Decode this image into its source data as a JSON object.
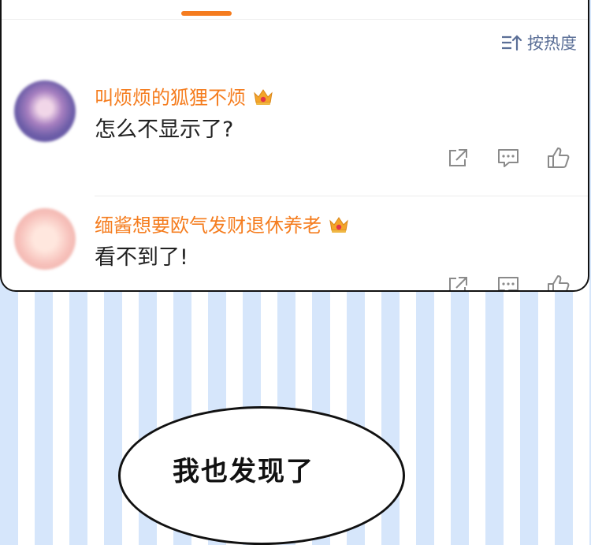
{
  "sort": {
    "label": "按热度"
  },
  "comments": [
    {
      "username": "叫烦烦的狐狸不烦",
      "text": "怎么不显示了?"
    },
    {
      "username": "缅酱想要欧气发财退休养老",
      "text": "看不到了!"
    }
  ],
  "bubble": {
    "text": "我也发现了"
  },
  "colors": {
    "accent": "#f57c1f",
    "sort_text": "#5b6f97",
    "stripe": "#d6e6fb"
  }
}
